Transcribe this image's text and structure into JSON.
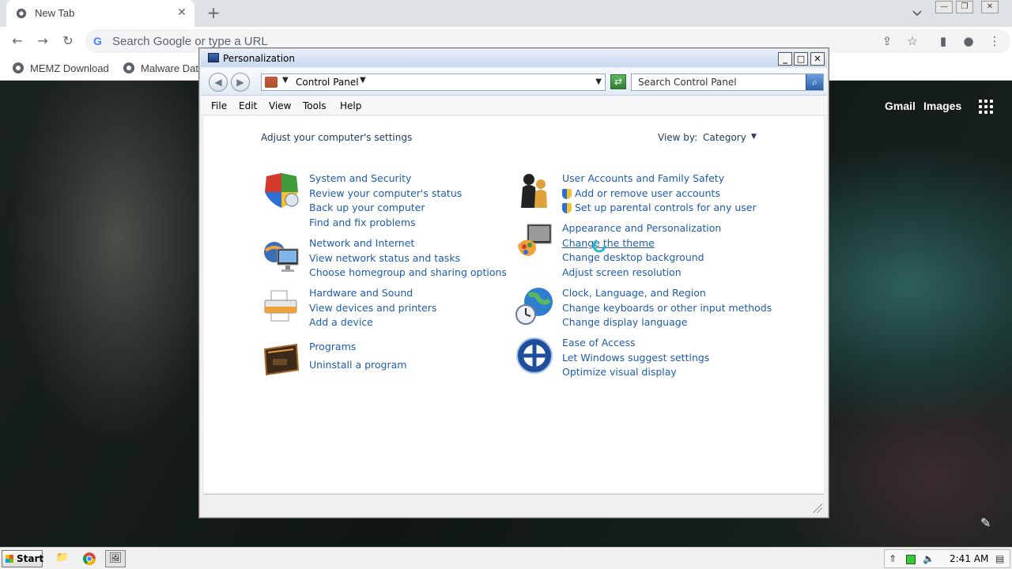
{
  "browser": {
    "tab_title": "New Tab",
    "tab_close": "✕",
    "new_tab": "+",
    "omnibox_placeholder": "Search Google or type a URL",
    "bookmarks": [
      "MEMZ Download",
      "Malware Dat"
    ]
  },
  "ntp": {
    "gmail": "Gmail",
    "images": "Images"
  },
  "window": {
    "title": "Personalization",
    "breadcrumb": "Control Panel",
    "search_placeholder": "Search Control Panel",
    "menu": [
      "File",
      "Edit",
      "View",
      "Tools",
      "Help"
    ],
    "heading": "Adjust your computer's settings",
    "view_by_label": "View by:",
    "view_by_value": "Category",
    "categories": [
      {
        "title": "System and Security",
        "links": [
          "Review your computer's status",
          "Back up your computer",
          "Find and fix problems"
        ],
        "icon": "shield-icon"
      },
      {
        "title": "Network and Internet",
        "links": [
          "View network status and tasks",
          "Choose homegroup and sharing options"
        ],
        "icon": "network-icon"
      },
      {
        "title": "Hardware and Sound",
        "links": [
          "View devices and printers",
          "Add a device"
        ],
        "icon": "printer-icon"
      },
      {
        "title": "Programs",
        "links": [
          "Uninstall a program"
        ],
        "icon": "programs-icon"
      },
      {
        "title": "User Accounts and Family Safety",
        "links": [
          "Add or remove user accounts",
          "Set up parental controls for any user"
        ],
        "icon": "users-icon"
      },
      {
        "title": "Appearance and Personalization",
        "links": [
          "Change the theme",
          "Change desktop background",
          "Adjust screen resolution"
        ],
        "icon": "appearance-icon"
      },
      {
        "title": "Clock, Language, and Region",
        "links": [
          "Change keyboards or other input methods",
          "Change display language"
        ],
        "icon": "globe-clock-icon"
      },
      {
        "title": "Ease of Access",
        "links": [
          "Let Windows suggest settings",
          "Optimize visual display"
        ],
        "icon": "ease-of-access-icon"
      }
    ]
  },
  "taskbar": {
    "start": "Start",
    "clock": "2:41 AM"
  },
  "colors": {
    "link": "#1e5cab",
    "heading": "#1e395b",
    "chrome_bg": "#dee1e6"
  }
}
